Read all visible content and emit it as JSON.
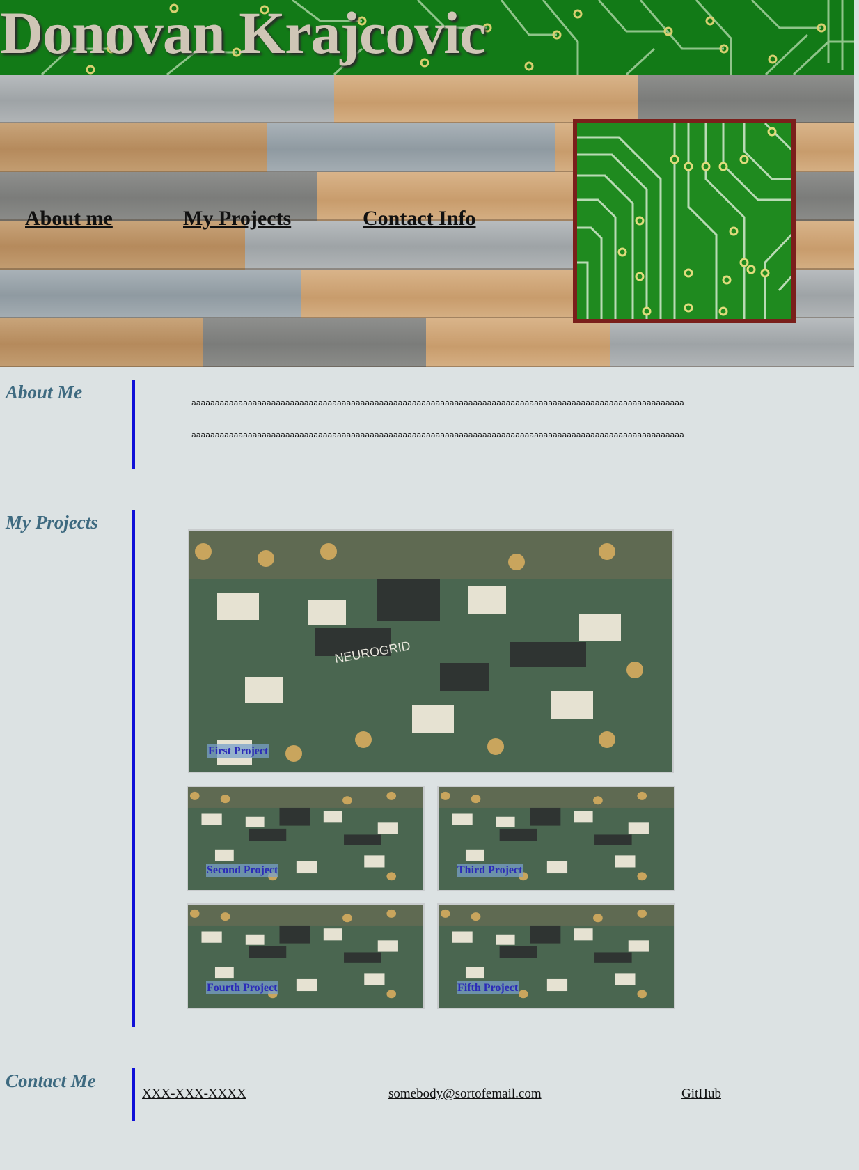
{
  "header": {
    "title": "Donovan Krajcovic"
  },
  "nav": {
    "items": [
      {
        "label": "About me"
      },
      {
        "label": "My Projects"
      },
      {
        "label": "Contact Info"
      }
    ]
  },
  "about": {
    "heading": "About Me",
    "lines": [
      "aaaaaaaaaaaaaaaaaaaaaaaaaaaaaaaaaaaaaaaaaaaaaaaaaaaaaaaaaaaaaaaaaaaaaaaaaaaaaaaaaaaaaaaaaaaaaaaaaaaaaaaaa",
      "aaaaaaaaaaaaaaaaaaaaaaaaaaaaaaaaaaaaaaaaaaaaaaaaaaaaaaaaaaaaaaaaaaaaaaaaaaaaaaaaaaaaaaaaaaaaaaaaaaaaaaaaa"
    ]
  },
  "projects": {
    "heading": "My Projects",
    "items": [
      {
        "label": "First Project"
      },
      {
        "label": "Second Project"
      },
      {
        "label": "Third Project"
      },
      {
        "label": "Fourth Project"
      },
      {
        "label": "Fifth Project"
      }
    ]
  },
  "contact": {
    "heading": "Contact Me",
    "phone": "XXX-XXX-XXXX",
    "email": "somebody@sortofemail.com",
    "github": "GitHub"
  },
  "colors": {
    "background": "#dce2e3",
    "accent_bar": "#1010d8",
    "heading": "#3e6a80",
    "circuit_green": "#127a17",
    "frame": "#7a1f1b"
  },
  "icons": {
    "banner": "circuit-board-pattern",
    "logo": "circuit-board-logo",
    "project_image": "circuit-board-photo"
  }
}
